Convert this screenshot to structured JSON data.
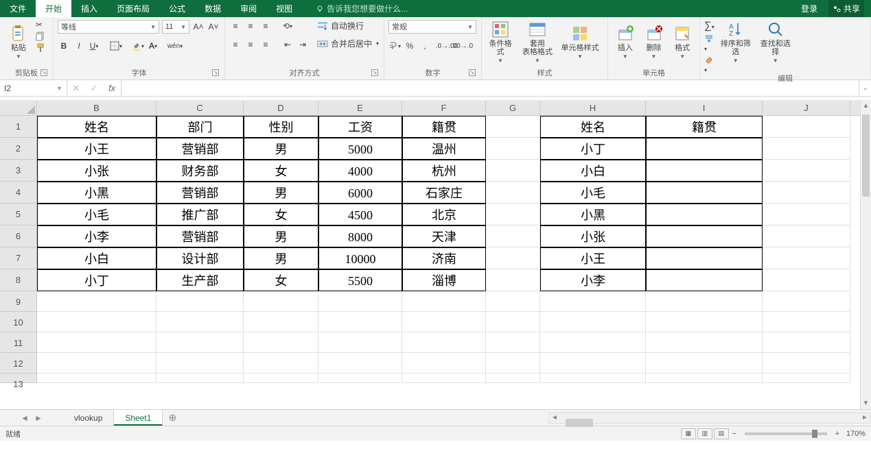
{
  "tabs": {
    "file": "文件",
    "home": "开始",
    "insert": "插入",
    "layout": "页面布局",
    "formula": "公式",
    "data": "数据",
    "review": "审阅",
    "view": "视图"
  },
  "tell_me": "告诉我您想要做什么...",
  "login": "登录",
  "share": "共享",
  "ribbon": {
    "clipboard": {
      "paste": "粘贴",
      "label": "剪贴板"
    },
    "font": {
      "name": "等线",
      "size": "11",
      "label": "字体"
    },
    "align": {
      "wrap": "自动换行",
      "merge": "合并后居中",
      "label": "对齐方式"
    },
    "number": {
      "format": "常规",
      "label": "数字"
    },
    "styles": {
      "cond": "条件格式",
      "table": "套用\n表格格式",
      "cell": "单元格样式",
      "label": "样式"
    },
    "cells": {
      "insert": "插入",
      "delete": "删除",
      "format": "格式",
      "label": "单元格"
    },
    "editing": {
      "sort": "排序和筛选",
      "find": "查找和选择",
      "label": "编辑"
    }
  },
  "name_box": "I2",
  "formula": "",
  "columns": [
    "B",
    "C",
    "D",
    "E",
    "F",
    "G",
    "H",
    "I",
    "J"
  ],
  "col_widths": [
    "cw-B",
    "cw-C",
    "cw-D",
    "cw-E",
    "cw-F",
    "cw-G",
    "cw-H",
    "cw-I",
    "cw-J"
  ],
  "row_nums": [
    "1",
    "2",
    "3",
    "4",
    "5",
    "6",
    "7",
    "8",
    "9",
    "10",
    "11",
    "12",
    "13"
  ],
  "data_block1": {
    "range": {
      "row_start": 1,
      "row_end": 8,
      "cols": [
        "B",
        "C",
        "D",
        "E",
        "F"
      ]
    },
    "rows": [
      [
        "姓名",
        "部门",
        "性别",
        "工资",
        "籍贯"
      ],
      [
        "小王",
        "营销部",
        "男",
        "5000",
        "温州"
      ],
      [
        "小张",
        "财务部",
        "女",
        "4000",
        "杭州"
      ],
      [
        "小黑",
        "营销部",
        "男",
        "6000",
        "石家庄"
      ],
      [
        "小毛",
        "推广部",
        "女",
        "4500",
        "北京"
      ],
      [
        "小李",
        "营销部",
        "男",
        "8000",
        "天津"
      ],
      [
        "小白",
        "设计部",
        "男",
        "10000",
        "济南"
      ],
      [
        "小丁",
        "生产部",
        "女",
        "5500",
        "淄博"
      ]
    ]
  },
  "data_block2": {
    "range": {
      "row_start": 1,
      "row_end": 8,
      "cols": [
        "H",
        "I"
      ]
    },
    "rows": [
      [
        "姓名",
        "籍贯"
      ],
      [
        "小丁",
        ""
      ],
      [
        "小白",
        ""
      ],
      [
        "小毛",
        ""
      ],
      [
        "小黑",
        ""
      ],
      [
        "小张",
        ""
      ],
      [
        "小王",
        ""
      ],
      [
        "小李",
        ""
      ]
    ]
  },
  "sheets": {
    "s1": "vlookup",
    "s2": "Sheet1",
    "active": "s2"
  },
  "status": {
    "ready": "就绪",
    "zoom": "170%"
  }
}
